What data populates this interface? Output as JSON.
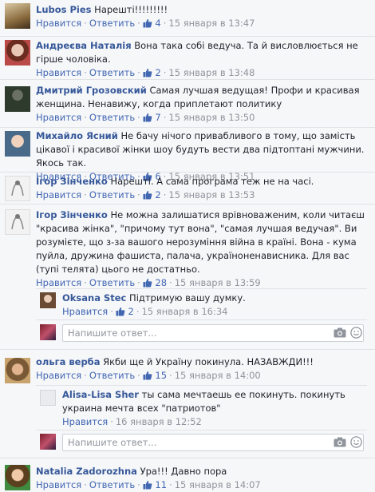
{
  "labels": {
    "like": "Нравится",
    "reply": "Ответить",
    "reply_placeholder": "Напишите ответ..."
  },
  "comments": [
    {
      "author": "Lubos Pies",
      "text": "Нарешті!!!!!!!!!",
      "likes": "4",
      "time": "15 января в 13:47"
    },
    {
      "author": "Андреєва Наталія",
      "text": "Вона така собі ведуча. Та й висловлюється не гірше чоловіка.",
      "likes": "2",
      "time": "15 января в 13:48"
    },
    {
      "author": "Дмитрий Грозовский",
      "text": "Самая лучшая ведущая! Профи и красивая женщина. Ненавижу, когда приплетают политику",
      "likes": "7",
      "time": "15 января в 13:50"
    },
    {
      "author": "Михайло Ясний",
      "text": "Не бачу нічого привабливого в тому, що замість цікавої і красивої жінки шоу будуть вести два підтоптані мужчини. Якось так.",
      "likes": "6",
      "time": "15 января в 13:51"
    },
    {
      "author": "Ігор Зінченко",
      "text": "Нарешті. А сама програма теж не на часі.",
      "likes": "2",
      "time": "15 января в 13:53"
    },
    {
      "author": "Ігор Зінченко",
      "text": "Не можна залишатися врівноваженим, коли читаєш \"красива жінка\", \"причому тут вона\", \"самая лучшая ведучая\". Ви розумієте, що з-за вашого нерозуміння війна в країні. Вона - кума пуйла, дружина фашиста, палача, україноненависника. Для вас (тупі телята) цього не достатньо.",
      "likes": "28",
      "time": "15 января в 13:59"
    },
    {
      "author": "ольга верба",
      "text": "Якби ще й Україну покинула. НАЗАВЖДИ!!!",
      "likes": "15",
      "time": "15 января в 14:00"
    },
    {
      "author": "Natalia Zadorozhna",
      "text": "Ура!!! Давно пора",
      "likes": "11",
      "time": "15 января в 14:07"
    }
  ],
  "replies": [
    {
      "author": "Oksana Stec",
      "text": "Підтримую вашу думку.",
      "likes": "2",
      "time": "15 января в 16:34"
    },
    {
      "author": "Alisa-Lisa Sher",
      "text": "ты сама мечтаешь ее покинуть. покинуть украина мечта всех \"патриотов\"",
      "time": "16 января в 12:52"
    }
  ],
  "colors": {
    "author": "#365899",
    "link": "#4267b2",
    "meta": "#90949c",
    "background": "#f6f7f9"
  },
  "icons": [
    "thumbs-up-icon",
    "camera-icon",
    "smiley-icon"
  ]
}
